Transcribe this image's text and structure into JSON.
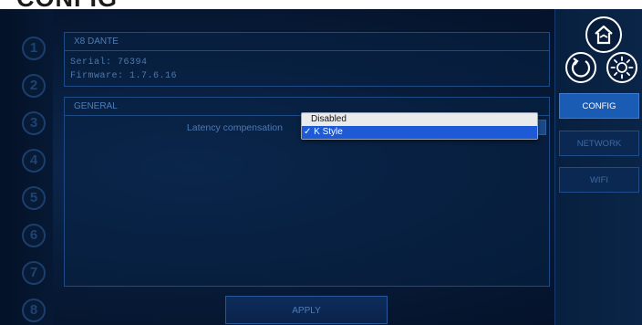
{
  "page_title": "CONFIG",
  "channels": [
    "1",
    "2",
    "3",
    "4",
    "5",
    "6",
    "7",
    "8"
  ],
  "device": {
    "name": "X8 DANTE",
    "serial_line": "Serial: 76394",
    "firmware_line": "Firmware: 1.7.6.16"
  },
  "general": {
    "header": "GENERAL",
    "latency_label": "Latency compensation",
    "latency_options": [
      "Disabled",
      "✓ K Style"
    ],
    "latency_selected": "K Style"
  },
  "apply_label": "APPLY",
  "nav": {
    "items": [
      "CONFIG",
      "NETWORK",
      "WIFI"
    ],
    "active": "CONFIG"
  },
  "icons": [
    "home-icon",
    "refresh-icon",
    "brightness-icon"
  ],
  "colors": {
    "background": "#071a36",
    "panel_border": "#1e4a86",
    "active_nav": "#1a5bb3",
    "dropdown_highlight": "#1e5ad8"
  }
}
